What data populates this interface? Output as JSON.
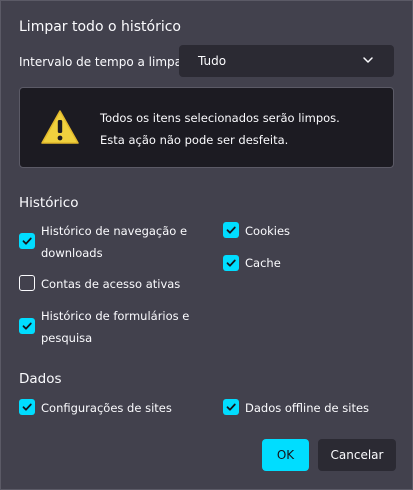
{
  "dialog": {
    "title": "Limpar todo o histórico",
    "range_label": "Intervalo de tempo a limpar:",
    "range_value": "Tudo",
    "warning": {
      "line1": "Todos os itens selecionados serão limpos.",
      "line2": "Esta ação não pode ser desfeita."
    },
    "history_section": "Histórico",
    "history_items": [
      {
        "line1": "Histórico de navegação e",
        "line2": "downloads",
        "checked": true
      },
      {
        "label": "Cookies",
        "checked": true
      },
      {
        "label": "Contas de acesso ativas",
        "checked": false
      },
      {
        "label": "Cache",
        "checked": true
      },
      {
        "line1": "Histórico de formulários e",
        "line2": "pesquisa",
        "checked": true
      }
    ],
    "data_section": "Dados",
    "data_items": [
      {
        "label": "Configurações de sites",
        "checked": true
      },
      {
        "label": "Dados offline de sites",
        "checked": true
      }
    ],
    "buttons": {
      "ok": "OK",
      "cancel": "Cancelar"
    }
  },
  "colors": {
    "background": "#42414d",
    "accent": "#00ddff",
    "field": "#2b2a33",
    "warning_box": "#1c1b22",
    "text": "#fbfbfe"
  }
}
